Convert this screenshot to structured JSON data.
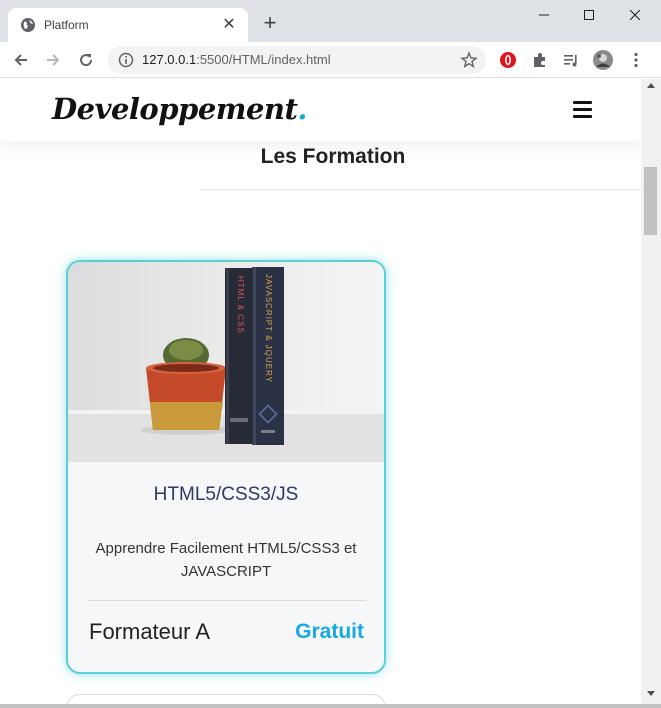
{
  "browser": {
    "tab_title": "Platform",
    "url_host": "127.0.0.1",
    "url_path": ":5500/HTML/index.html"
  },
  "site": {
    "brand": "Developpement",
    "brand_dot": "."
  },
  "section": {
    "title": "Les Formation"
  },
  "course": {
    "title": "HTML5/CSS3/JS",
    "description": "Apprendre Facilement HTML5/CSS3 et JAVASCRIPT",
    "author": "Formateur A",
    "price": "Gratuit",
    "book1_spine": "HTML & CSS",
    "book2_spine": "JAVASCRIPT & JQUERY"
  },
  "colors": {
    "accent": "#1ba7e0",
    "card_border": "#5ad0d6",
    "tabstrip": "#dee1e6"
  },
  "icons": {
    "favicon": "globe-icon",
    "menu": "hamburger-menu-icon",
    "back": "back-arrow-icon",
    "forward": "forward-arrow-icon",
    "reload": "reload-icon",
    "info": "info-icon",
    "bookmark": "star-icon"
  }
}
